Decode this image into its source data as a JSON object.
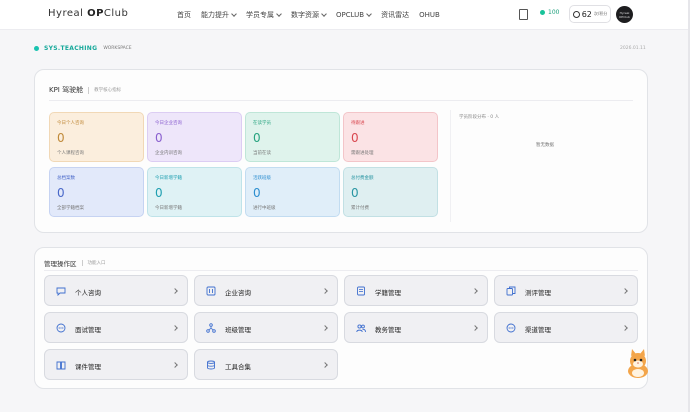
{
  "app": {
    "logo_prefix": "Hyreal ",
    "logo_op": "OP",
    "logo_suffix": "Club"
  },
  "nav": {
    "items": [
      {
        "label": "首页",
        "dropdown": false
      },
      {
        "label": "能力提升",
        "dropdown": true
      },
      {
        "label": "学员专属",
        "dropdown": true
      },
      {
        "label": "数字资源",
        "dropdown": true
      },
      {
        "label": "OPCLUB",
        "dropdown": true
      },
      {
        "label": "资讯雷达",
        "dropdown": false
      },
      {
        "label": "OHUB",
        "dropdown": false
      }
    ],
    "status_value": "100",
    "points_value": "62",
    "points_unit": "次/积分",
    "avatar_text": "Hyreal OPClub"
  },
  "header": {
    "section": "SYS.TEACHING",
    "workspace": "WORKSPACE",
    "date": "2026.01.11"
  },
  "kpi": {
    "title": "KPI 驾驶舱",
    "subtitle": "教学核心指标",
    "cards": [
      {
        "label": "今日个人咨询",
        "value": "0",
        "desc": "个人课程咨询",
        "color": "#c08a3a",
        "bg": "#fbeedd",
        "border": "#f1d8b6"
      },
      {
        "label": "今日企业咨询",
        "value": "0",
        "desc": "企业内训咨询",
        "color": "#8a5fcf",
        "bg": "#eee6fa",
        "border": "#dccdf3"
      },
      {
        "label": "在读学员",
        "value": "0",
        "desc": "当前在读",
        "color": "#26a37f",
        "bg": "#dff3ec",
        "border": "#bfe6d8"
      },
      {
        "label": "待跟进",
        "value": "0",
        "desc": "需跟进处理",
        "color": "#d9474f",
        "bg": "#fbe3e5",
        "border": "#f3c5c9"
      },
      {
        "label": "总档案数",
        "value": "0",
        "desc": "全部学籍档案",
        "color": "#4968c9",
        "bg": "#e2e9fa",
        "border": "#c6d3f2"
      },
      {
        "label": "今日新增学籍",
        "value": "0",
        "desc": "今日新增学籍",
        "color": "#1e9fb0",
        "bg": "#dff2f5",
        "border": "#bfe3e9"
      },
      {
        "label": "活跃班级",
        "value": "0",
        "desc": "进行中班级",
        "color": "#2c8ed0",
        "bg": "#e0eef9",
        "border": "#c2dcf1"
      },
      {
        "label": "总付费金额",
        "value": "0",
        "desc": "累计付费",
        "color": "#2895a2",
        "bg": "#dfeff1",
        "border": "#c2e0e4"
      }
    ],
    "distribution_title": "学员阶段分布",
    "distribution_count": "0 人",
    "empty_text": "暂无数据"
  },
  "mgmt": {
    "title": "管理操作区",
    "subtitle": "功能入口",
    "tiles": [
      {
        "label": "个人咨询",
        "icon": "chat-icon"
      },
      {
        "label": "企业咨询",
        "icon": "building-icon"
      },
      {
        "label": "学籍管理",
        "icon": "document-icon"
      },
      {
        "label": "测评管理",
        "icon": "copy-icon"
      },
      {
        "label": "面试管理",
        "icon": "dots-chat-icon"
      },
      {
        "label": "班级管理",
        "icon": "network-icon"
      },
      {
        "label": "教务管理",
        "icon": "users-icon"
      },
      {
        "label": "渠道管理",
        "icon": "dots-chat-icon"
      },
      {
        "label": "课件管理",
        "icon": "book-icon"
      },
      {
        "label": "工具合集",
        "icon": "database-icon"
      }
    ]
  },
  "colors": {
    "accent": "#19c3b0",
    "icon_blue": "#3f6fcf"
  }
}
